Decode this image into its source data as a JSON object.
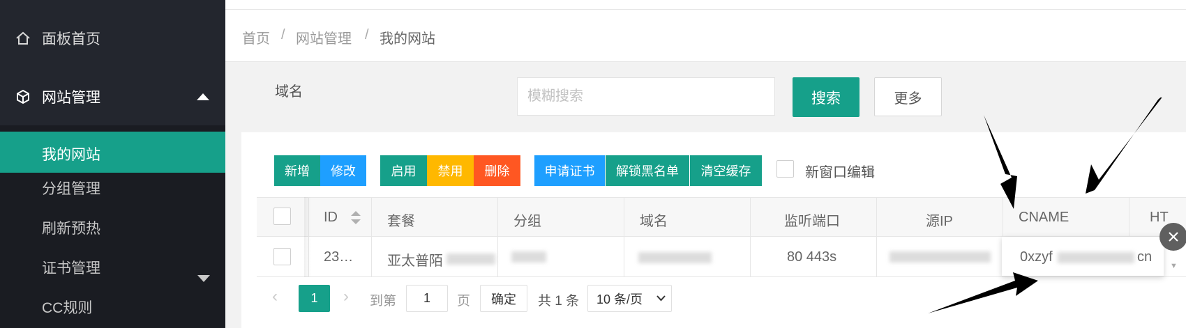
{
  "sidebar": {
    "home": "面板首页",
    "site_mgmt": "网站管理",
    "items": [
      "我的网站",
      "分组管理",
      "刷新预热",
      "证书管理",
      "CC规则"
    ]
  },
  "breadcrumb": {
    "items": [
      "首页",
      "网站管理",
      "我的网站"
    ],
    "separator": "/"
  },
  "search": {
    "label": "域名",
    "placeholder": "模糊搜索",
    "value": "",
    "search_btn": "搜索",
    "more_btn": "更多"
  },
  "toolbar": {
    "add": "新增",
    "edit": "修改",
    "enable": "启用",
    "disable": "禁用",
    "delete": "删除",
    "apply_cert": "申请证书",
    "unlock_blacklist": "解锁黑名单",
    "clear_cache": "清空缓存",
    "new_window_edit": "新窗口编辑"
  },
  "table": {
    "columns": [
      "ID",
      "套餐",
      "分组",
      "域名",
      "监听端口",
      "源IP",
      "CNAME",
      "HT"
    ],
    "row": {
      "id": "23…",
      "plan": "亚太普陌",
      "ports": "80 443s",
      "cname_start": "0xzyf",
      "cname_end": "cn"
    }
  },
  "pager": {
    "current": "1",
    "goto_label": "到第",
    "goto_value": "1",
    "page_label": "页",
    "confirm": "确定",
    "total": "共 1 条",
    "page_size": "10 条/页"
  },
  "colors": {
    "primary": "#16a08a",
    "blue": "#1e9fff",
    "orange": "#ffb800",
    "red": "#ff5722",
    "sidebar": "#23262e"
  }
}
